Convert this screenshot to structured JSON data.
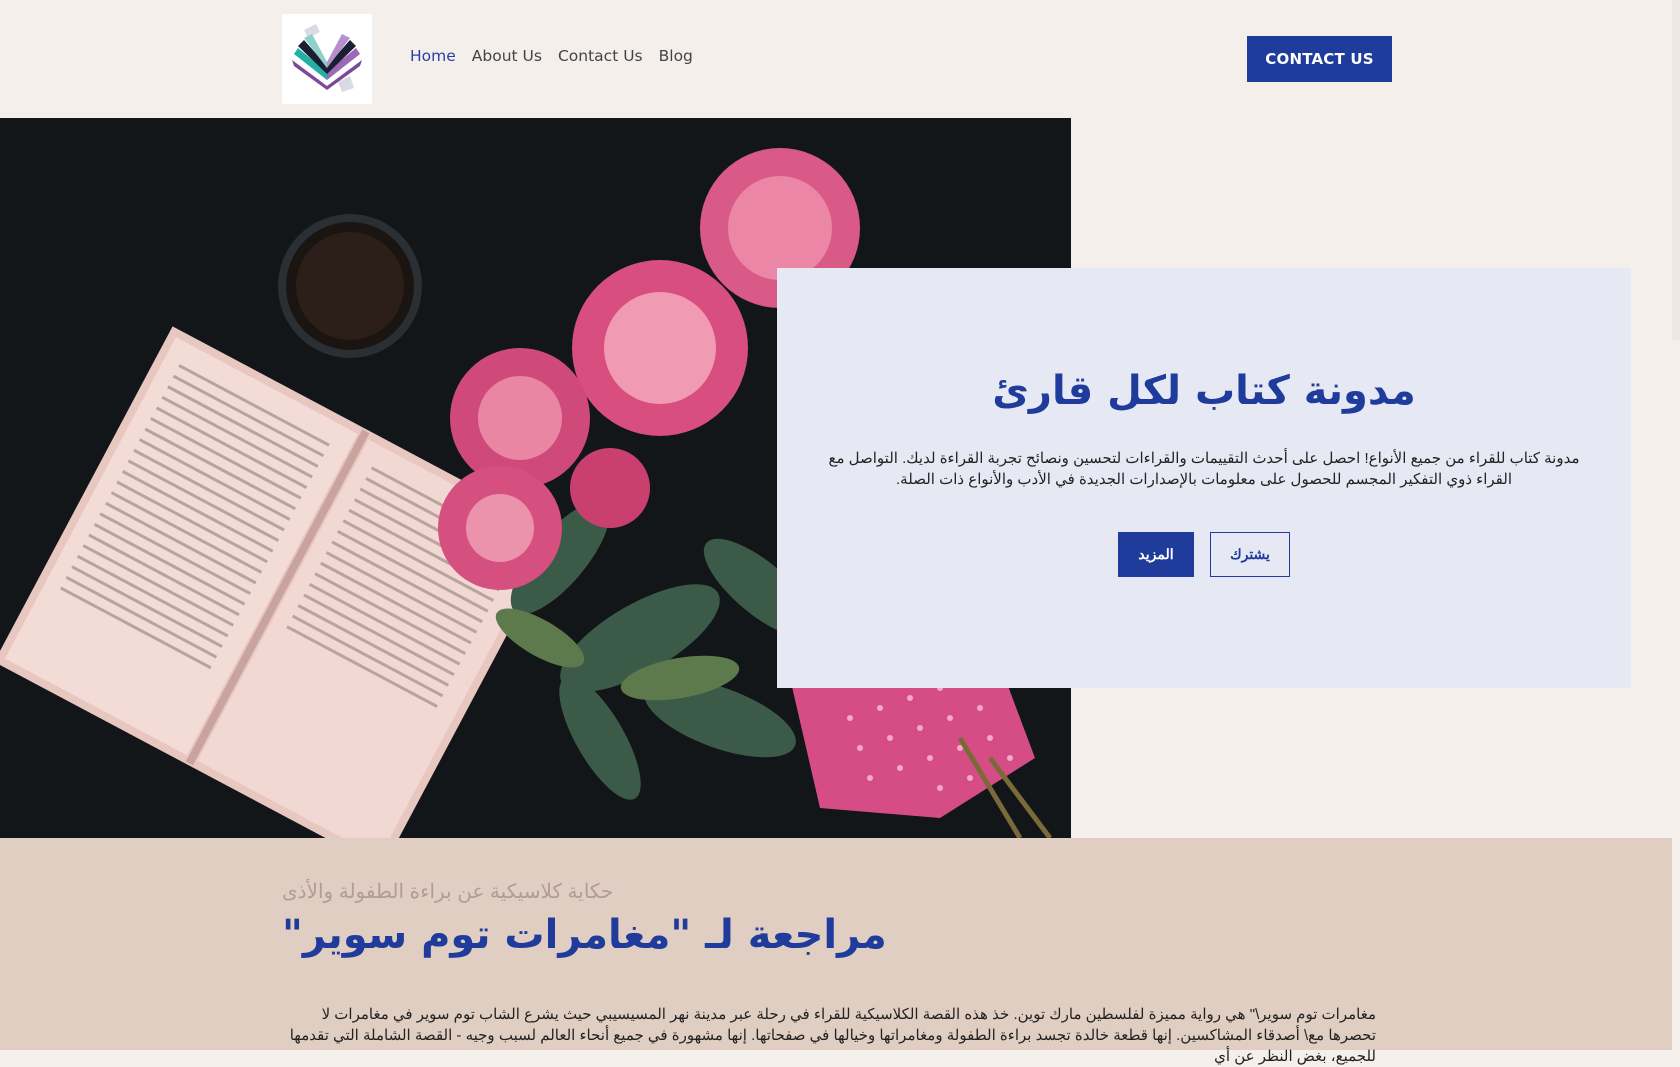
{
  "header": {
    "logo_alt": "book-blog-logo",
    "nav": [
      {
        "label": "Home",
        "active": true
      },
      {
        "label": "About Us",
        "active": false
      },
      {
        "label": "Contact Us",
        "active": false
      },
      {
        "label": "Blog",
        "active": false
      }
    ],
    "cta_label": "CONTACT US"
  },
  "hero": {
    "title": "مدونة كتاب لكل قارئ",
    "text": "مدونة كتاب للقراء من جميع الأنواع! احصل على أحدث التقييمات والقراءات لتحسين ونصائح تجربة القراءة لديك. التواصل مع القراء ذوي التفكير المجسم للحصول على معلومات بالإصدارات الجديدة في الأدب والأنواع ذات الصلة.",
    "subscribe_label": "يشترك",
    "more_label": "المزيد",
    "image_subject": "open book, coffee cup and pink peonies on dark background"
  },
  "article": {
    "kicker": "حكاية كلاسيكية عن براءة الطفولة والأذى",
    "title": "مراجعة لـ \"مغامرات توم سوير\"",
    "body": "مغامرات توم سوير\\\" هي رواية مميزة لفلسطين مارك توين. خذ هذه القصة الكلاسيكية للقراء في رحلة عبر مدينة نهر المسيسيبي حيث يشرع الشاب توم سوير في مغامرات لا تحصرها مع\\ أصدقاء المشاكسين. إنها قطعة خالدة تجسد براءة الطفولة ومغامراتها وخيالها في صفحاتها. إنها مشهورة في جميع أنحاء العالم لسبب وجيه - القصة الشاملة التي تقدمها للجميع، بغض النظر عن أي"
  },
  "colors": {
    "brand_blue": "#1f3b9b",
    "page_bg": "#f5efec",
    "card_bg": "#e6e9f3",
    "article_bg": "#e0cec2"
  }
}
